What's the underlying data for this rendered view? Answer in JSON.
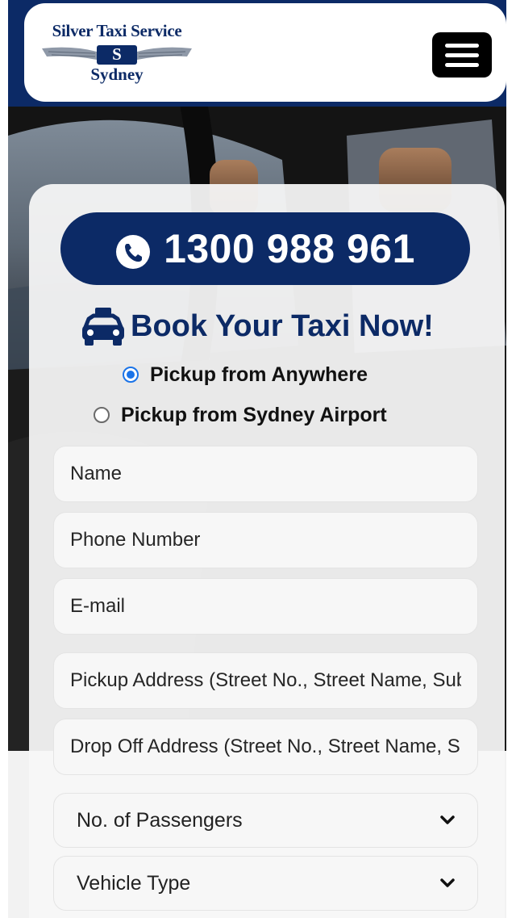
{
  "header": {
    "logo": {
      "line1": "Silver Taxi Service",
      "badge": "S",
      "line2": "Sydney"
    },
    "menu_icon": "hamburger-menu-icon"
  },
  "booking": {
    "phone_number": "1300 988 961",
    "phone_icon": "phone-icon",
    "title": "Book Your Taxi Now!",
    "title_icon": "taxi-icon",
    "pickup_options": [
      {
        "label": "Pickup from Anywhere",
        "checked": true
      },
      {
        "label": "Pickup from Sydney Airport",
        "checked": false
      }
    ],
    "fields": {
      "name_placeholder": "Name",
      "phone_placeholder": "Phone Number",
      "email_placeholder": "E-mail",
      "pickup_placeholder": "Pickup Address (Street No., Street Name, Suburb)",
      "dropoff_placeholder": "Drop Off Address (Street No., Street Name, Suburb)"
    },
    "passengers_select": {
      "selected": "No. of Passengers"
    },
    "vehicle_select": {
      "selected": "Vehicle Type"
    }
  },
  "colors": {
    "brand_navy": "#0c2a66",
    "radio_accent": "#1a73e8"
  }
}
